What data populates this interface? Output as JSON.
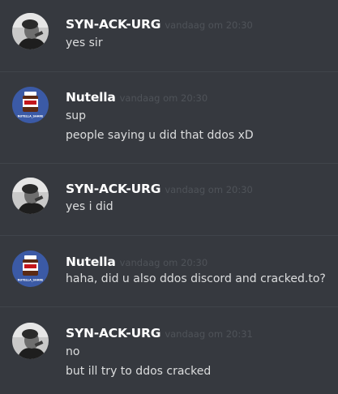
{
  "messages": [
    {
      "username": "SYN-ACK-URG",
      "avatar": "user-photo-avatar",
      "timestamp": "vandaag om 20:30",
      "lines": [
        "yes sir"
      ]
    },
    {
      "username": "Nutella",
      "avatar": "nutella-jar-avatar",
      "avatar_caption": "NUTELLA_SHARE",
      "timestamp": "vandaag om 20:30",
      "lines": [
        "sup",
        "people saying u did that ddos xD"
      ]
    },
    {
      "username": "SYN-ACK-URG",
      "avatar": "user-photo-avatar",
      "timestamp": "vandaag om 20:30",
      "lines": [
        "yes i did"
      ]
    },
    {
      "username": "Nutella",
      "avatar": "nutella-jar-avatar",
      "avatar_caption": "NUTELLA_SHARE",
      "timestamp": "vandaag om 20:30",
      "lines": [
        "haha, did u also ddos discord and cracked.to?"
      ]
    },
    {
      "username": "SYN-ACK-URG",
      "avatar": "user-photo-avatar",
      "timestamp": "vandaag om 20:31",
      "lines": [
        "no",
        "but ill try to ddos cracked"
      ]
    }
  ],
  "colors": {
    "background": "#36393f",
    "divider": "#40444b",
    "username": "#ffffff",
    "timestamp": "#4f5359",
    "text": "#dcddde",
    "nutella_avatar_bg": "#3b5aa6"
  }
}
